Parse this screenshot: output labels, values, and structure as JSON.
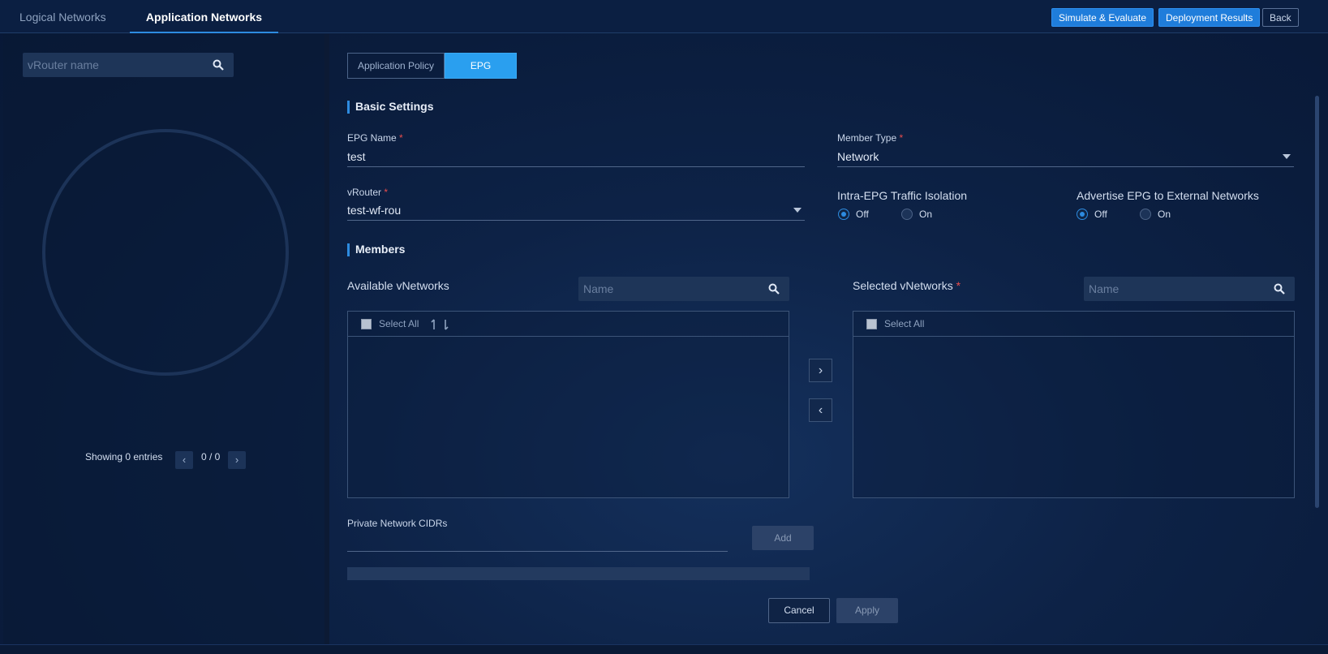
{
  "topbar": {
    "tabs": [
      {
        "label": "Logical Networks"
      },
      {
        "label": "Application Networks"
      }
    ],
    "simulate_label": "Simulate & Evaluate",
    "deployment_label": "Deployment Results",
    "back_label": "Back"
  },
  "left": {
    "search_placeholder": "vRouter name",
    "entries_text": "Showing 0 entries",
    "page_text": "0 / 0"
  },
  "main": {
    "subtabs": [
      {
        "label": "Application Policy"
      },
      {
        "label": "EPG"
      }
    ],
    "basic_settings_title": "Basic Settings",
    "epg_name_label": "EPG Name",
    "epg_name_value": "test",
    "member_type_label": "Member Type",
    "member_type_value": "Network",
    "vrouter_label": "vRouter",
    "vrouter_value": "test-wf-rou",
    "required_mark": "*",
    "isolation_label": "Intra-EPG Traffic Isolation",
    "isolation_off": "Off",
    "isolation_on": "On",
    "advertise_label": "Advertise EPG to External Networks",
    "advertise_off": "Off",
    "advertise_on": "On",
    "members_title": "Members",
    "available_label": "Available vNetworks",
    "available_search_placeholder": "Name",
    "available_select_all": "Select All",
    "selected_label": "Selected vNetworks",
    "selected_search_placeholder": "Name",
    "selected_select_all": "Select All",
    "cidr_label": "Private Network CIDRs",
    "add_label": "Add",
    "cancel_label": "Cancel",
    "apply_label": "Apply"
  },
  "colors": {
    "accent": "#2d8be0",
    "active_tab": "#2a9fef",
    "required": "#e84d4d"
  }
}
